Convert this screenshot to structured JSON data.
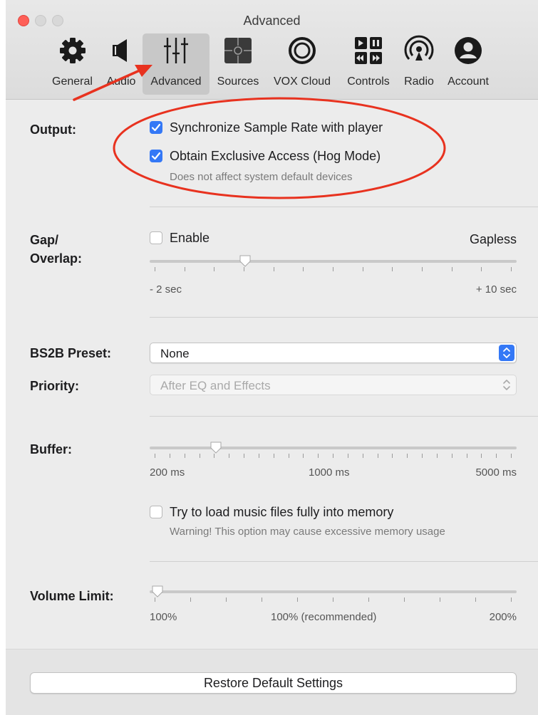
{
  "window": {
    "title": "Advanced"
  },
  "toolbar": {
    "items": [
      {
        "label": "General",
        "icon": "gear-icon"
      },
      {
        "label": "Audio",
        "icon": "speaker-icon"
      },
      {
        "label": "Advanced",
        "icon": "sliders-icon",
        "active": true
      },
      {
        "label": "Sources",
        "icon": "puzzle-icon"
      },
      {
        "label": "VOX Cloud",
        "icon": "cloud-rings-icon"
      },
      {
        "label": "Controls",
        "icon": "playback-controls-icon"
      },
      {
        "label": "Radio",
        "icon": "radio-broadcast-icon"
      },
      {
        "label": "Account",
        "icon": "user-icon"
      }
    ]
  },
  "output": {
    "label": "Output:",
    "sync_label": "Synchronize Sample Rate with player",
    "sync_checked": true,
    "hog_label": "Obtain Exclusive Access (Hog Mode)",
    "hog_checked": true,
    "hog_note": "Does not affect system default devices"
  },
  "gap": {
    "label_line1": "Gap/",
    "label_line2": "Overlap:",
    "enable_label": "Enable",
    "enable_checked": false,
    "mode_label": "Gapless",
    "min_label": "- 2 sec",
    "max_label": "+ 10 sec"
  },
  "bs2b": {
    "label": "BS2B Preset:",
    "value": "None"
  },
  "priority": {
    "label": "Priority:",
    "value": "After EQ and Effects",
    "enabled": false
  },
  "buffer": {
    "label": "Buffer:",
    "min_label": "200 ms",
    "mid_label": "1000 ms",
    "max_label": "5000 ms",
    "load_label": "Try to load music files fully into memory",
    "load_checked": false,
    "load_warning": "Warning! This option may cause excessive memory usage"
  },
  "volume": {
    "label": "Volume Limit:",
    "min_label": "100%",
    "mid_label": "100% (recommended)",
    "max_label": "200%"
  },
  "footer": {
    "restore_label": "Restore Default Settings"
  },
  "colors": {
    "accent": "#3478f6",
    "annotation": "#e8321f",
    "close": "#fe5f57"
  }
}
